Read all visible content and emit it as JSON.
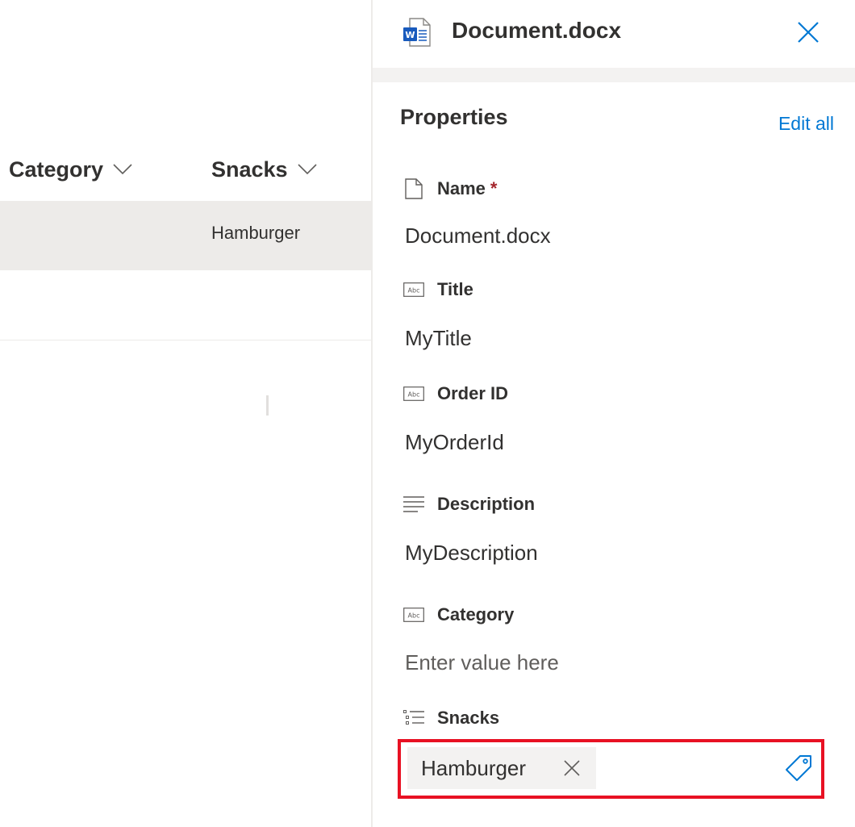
{
  "list": {
    "columns": [
      {
        "label": "Category"
      },
      {
        "label": "Snacks"
      }
    ],
    "rows": [
      {
        "snacks": "Hamburger"
      }
    ]
  },
  "panel": {
    "file_name": "Document.docx",
    "section_title": "Properties",
    "edit_all": "Edit all",
    "properties": {
      "name": {
        "label": "Name",
        "required_mark": "*",
        "value": "Document.docx",
        "icon": "document-icon"
      },
      "title": {
        "label": "Title",
        "value": "MyTitle",
        "icon": "text-field-icon"
      },
      "order_id": {
        "label": "Order ID",
        "value": "MyOrderId",
        "icon": "text-field-icon"
      },
      "description": {
        "label": "Description",
        "value": "MyDescription",
        "icon": "multiline-text-icon"
      },
      "category": {
        "label": "Category",
        "placeholder": "Enter value here",
        "icon": "text-field-icon"
      },
      "snacks": {
        "label": "Snacks",
        "tag": "Hamburger",
        "icon": "bullet-list-icon"
      }
    }
  },
  "colors": {
    "accent": "#0078d4",
    "required": "#a4262c",
    "highlight_border": "#e81123",
    "word_blue": "#185abd"
  }
}
